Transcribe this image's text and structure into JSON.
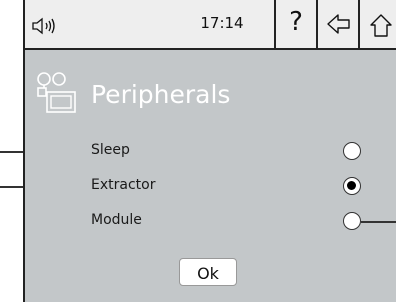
{
  "status": {
    "time": "17:14"
  },
  "toolbar": {
    "help_label": "?"
  },
  "header": {
    "title": "Peripherals"
  },
  "options": [
    {
      "label": "Sleep",
      "checked": false
    },
    {
      "label": "Extractor",
      "checked": true
    },
    {
      "label": "Module",
      "checked": false
    }
  ],
  "footer": {
    "ok_label": "Ok"
  },
  "icons": [
    "speaker-icon",
    "help-icon",
    "back-arrow-icon",
    "home-icon",
    "peripherals-icon"
  ]
}
